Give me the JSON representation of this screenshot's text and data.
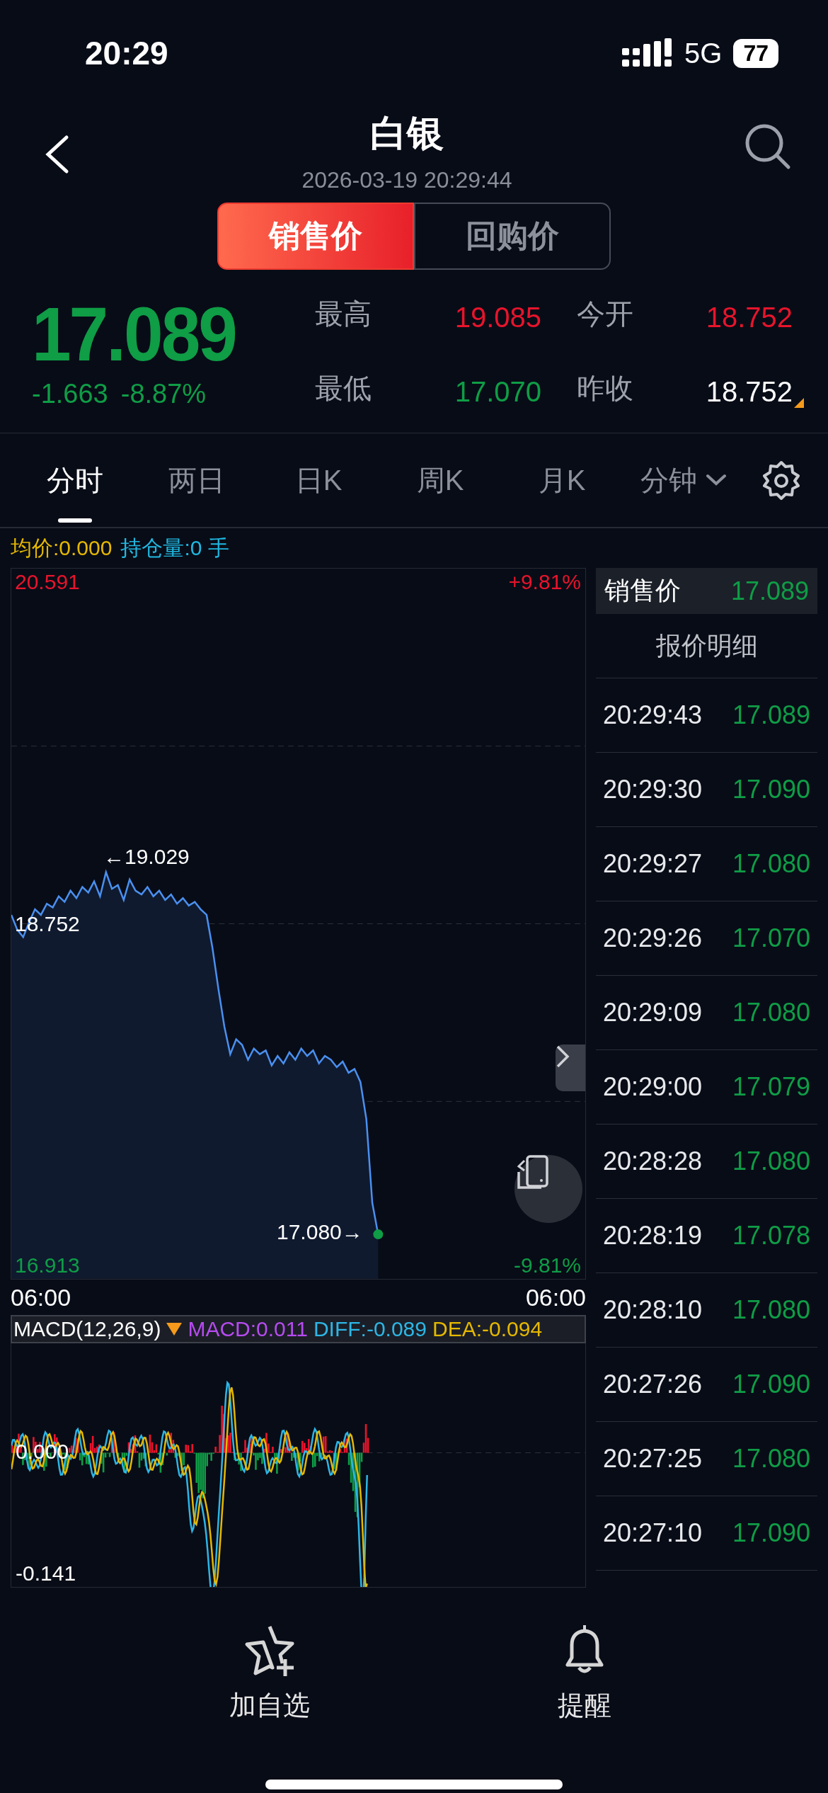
{
  "status_bar": {
    "time": "20:29",
    "network": "5G",
    "battery": "77"
  },
  "header": {
    "title": "白银",
    "timestamp": "2026-03-19 20:29:44"
  },
  "price_type": [
    {
      "label": "销售价",
      "selected": true
    },
    {
      "label": "回购价",
      "selected": false
    }
  ],
  "quote": {
    "price": "17.089",
    "change": "-1.663",
    "change_pct": "-8.87%",
    "stats": [
      {
        "label": "最高",
        "value": "19.085",
        "color": "#e8142c",
        "flag": false
      },
      {
        "label": "今开",
        "value": "18.752",
        "color": "#e8142c",
        "flag": false
      },
      {
        "label": "最低",
        "value": "17.070",
        "color": "#0f9d46",
        "flag": false
      },
      {
        "label": "昨收",
        "value": "18.752",
        "color": "#ffffff",
        "flag": true
      }
    ]
  },
  "tabs": [
    {
      "label": "分时",
      "selected": true,
      "kind": "plain"
    },
    {
      "label": "两日",
      "selected": false,
      "kind": "plain"
    },
    {
      "label": "日K",
      "selected": false,
      "kind": "plain"
    },
    {
      "label": "周K",
      "selected": false,
      "kind": "plain"
    },
    {
      "label": "月K",
      "selected": false,
      "kind": "plain"
    },
    {
      "label": "分钟",
      "selected": false,
      "kind": "dropdown"
    }
  ],
  "info": {
    "avg": "均价:0.000",
    "position": "持仓量:0 手"
  },
  "chart": {
    "chart_data": {
      "type": "line",
      "ylim": [
        16.841,
        20.663
      ],
      "yticks": [
        16.913,
        18.752,
        20.591
      ],
      "series": [
        {
          "color": "#4a90f0",
          "values": [
            18.8,
            18.72,
            18.68,
            18.76,
            18.83,
            18.8,
            18.86,
            18.84,
            18.9,
            18.87,
            18.93,
            18.89,
            18.95,
            18.92,
            18.98,
            18.9,
            19.03,
            18.94,
            18.96,
            18.88,
            18.99,
            18.93,
            18.91,
            18.95,
            18.9,
            18.93,
            18.88,
            18.91,
            18.86,
            18.89,
            18.85,
            18.87,
            18.83,
            18.8,
            18.62,
            18.4,
            18.2,
            18.05,
            18.13,
            18.1,
            18.02,
            18.08,
            18.05,
            18.07,
            17.99,
            18.04,
            18.0,
            18.06,
            18.02,
            18.08,
            18.04,
            18.07,
            18.0,
            18.04,
            18.02,
            17.98,
            18.01,
            17.95,
            17.97,
            17.9,
            17.7,
            17.25,
            17.08,
            null,
            null,
            null,
            null,
            null,
            null,
            null,
            null,
            null,
            null,
            null,
            null,
            null,
            null,
            null,
            null,
            null,
            null,
            null,
            null,
            null,
            null,
            null,
            null,
            null,
            null,
            null,
            null,
            null,
            null,
            null,
            null,
            null,
            null,
            null
          ]
        }
      ]
    },
    "top_price": "20.591",
    "top_pct": "+9.81%",
    "base_price": "18.752",
    "high_mark": "←19.029",
    "last_mark": "17.080→",
    "bottom_price": "16.913",
    "bottom_pct": "-9.81%",
    "start_time": "06:00",
    "end_time": "06:00"
  },
  "macd": {
    "name": "MACD(12,26,9)",
    "macd": "MACD:0.011",
    "diff": "DIFF:-0.089",
    "dea": "DEA:-0.094",
    "zero": "0.000",
    "low": "-0.141"
  },
  "ticker": {
    "label": "销售价",
    "price": "17.089",
    "title": "报价明细",
    "rows": [
      {
        "time": "20:29:43",
        "price": "17.089"
      },
      {
        "time": "20:29:30",
        "price": "17.090"
      },
      {
        "time": "20:29:27",
        "price": "17.080"
      },
      {
        "time": "20:29:26",
        "price": "17.070"
      },
      {
        "time": "20:29:09",
        "price": "17.080"
      },
      {
        "time": "20:29:00",
        "price": "17.079"
      },
      {
        "time": "20:28:28",
        "price": "17.080"
      },
      {
        "time": "20:28:19",
        "price": "17.078"
      },
      {
        "time": "20:28:10",
        "price": "17.080"
      },
      {
        "time": "20:27:26",
        "price": "17.090"
      },
      {
        "time": "20:27:25",
        "price": "17.080"
      },
      {
        "time": "20:27:10",
        "price": "17.090"
      }
    ]
  },
  "bottom_bar": [
    {
      "label": "加自选",
      "kind": "watchlist"
    },
    {
      "label": "提醒",
      "kind": "alert"
    }
  ]
}
